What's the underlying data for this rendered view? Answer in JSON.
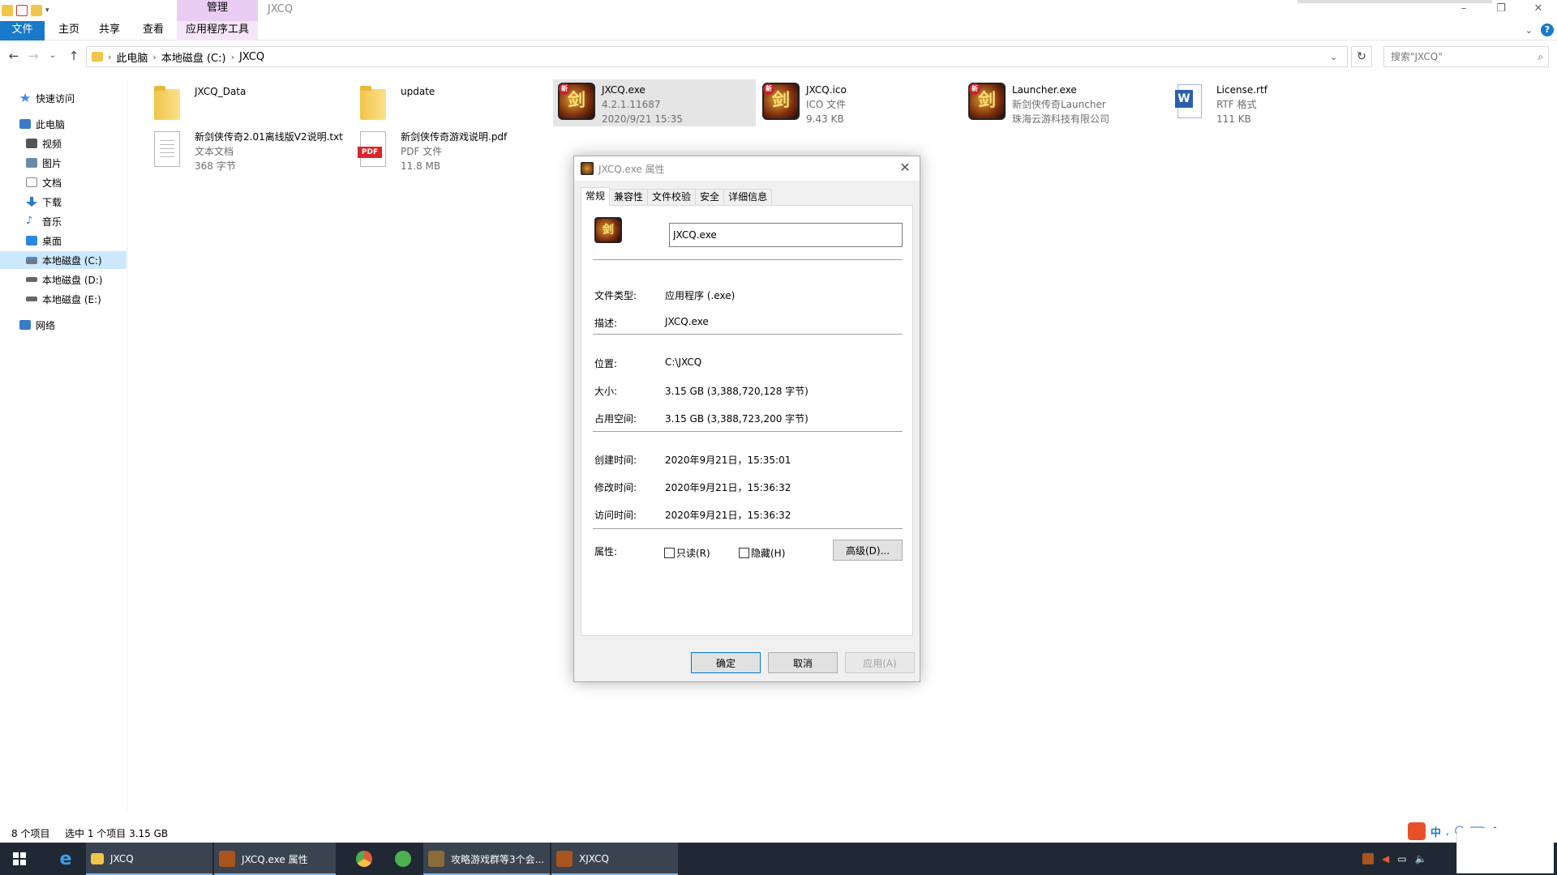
{
  "window": {
    "title": "JXCQ",
    "context_tab_header": "管理",
    "controls": [
      "–",
      "❐",
      "✕"
    ]
  },
  "ribbon": {
    "tabs": [
      "文件",
      "主页",
      "共享",
      "查看",
      "应用程序工具"
    ]
  },
  "address": {
    "breadcrumbs": [
      "此电脑",
      "本地磁盘 (C:)",
      "JXCQ"
    ],
    "search_placeholder": "搜索\"JXCQ\""
  },
  "nav": {
    "items": [
      {
        "label": "快速访问",
        "icon": "star-icon",
        "color": "#3d8ee0"
      },
      {
        "label": "此电脑",
        "icon": "computer-icon",
        "color": "#3a7bc8"
      },
      {
        "label": "视频",
        "icon": "video-icon",
        "color": "#555"
      },
      {
        "label": "图片",
        "icon": "picture-icon",
        "color": "#555"
      },
      {
        "label": "文档",
        "icon": "document-icon",
        "color": "#777"
      },
      {
        "label": "下载",
        "icon": "download-icon",
        "color": "#2a78d4"
      },
      {
        "label": "音乐",
        "icon": "music-icon",
        "color": "#2a78d4"
      },
      {
        "label": "桌面",
        "icon": "desktop-icon",
        "color": "#2a88e0"
      },
      {
        "label": "本地磁盘 (C:)",
        "icon": "drive-icon",
        "color": "#4a8ad4"
      },
      {
        "label": "本地磁盘 (D:)",
        "icon": "drive-icon",
        "color": "#666"
      },
      {
        "label": "本地磁盘 (E:)",
        "icon": "drive-icon",
        "color": "#666"
      },
      {
        "label": "网络",
        "icon": "network-icon",
        "color": "#3a7bc8"
      }
    ]
  },
  "files": [
    {
      "name": "JXCQ_Data",
      "lines": [],
      "icon": "folder-icon"
    },
    {
      "name": "update",
      "lines": [],
      "icon": "folder-icon"
    },
    {
      "name": "JXCQ.exe",
      "lines": [
        "4.2.1.11687",
        "2020/9/21 15:35"
      ],
      "icon": "game-icon"
    },
    {
      "name": "JXCQ.ico",
      "lines": [
        "ICO 文件",
        "9.43 KB"
      ],
      "icon": "game-icon"
    },
    {
      "name": "Launcher.exe",
      "lines": [
        "新剑侠传奇Launcher",
        "珠海云游科技有限公司"
      ],
      "icon": "game-icon"
    },
    {
      "name": "License.rtf",
      "lines": [
        "RTF 格式",
        "111 KB"
      ],
      "icon": "word-icon"
    },
    {
      "name": "新剑侠传奇2.01离线版V2说明.txt",
      "lines": [
        "文本文档",
        "368 字节"
      ],
      "icon": "text-file-icon"
    },
    {
      "name": "新剑侠传奇游戏说明.pdf",
      "lines": [
        "PDF 文件",
        "11.8 MB"
      ],
      "icon": "pdf-icon"
    }
  ],
  "game_icon_badge": "新",
  "game_icon_glyph": "剑",
  "pdf_label": "PDF",
  "word_label": "W",
  "dialog": {
    "title": "JXCQ.exe 属性",
    "tabs": [
      "常规",
      "兼容性",
      "文件校验",
      "安全",
      "详细信息"
    ],
    "file_name": "JXCQ.exe",
    "props": {
      "type_label": "文件类型:",
      "type_value": "应用程序 (.exe)",
      "desc_label": "描述:",
      "desc_value": "JXCQ.exe",
      "loc_label": "位置:",
      "loc_value": "C:\\JXCQ",
      "size_label": "大小:",
      "size_value": "3.15 GB (3,388,720,128 字节)",
      "disk_label": "占用空间:",
      "disk_value": "3.15 GB (3,388,723,200 字节)",
      "created_label": "创建时间:",
      "created_value": "2020年9月21日，15:35:01",
      "modified_label": "修改时间:",
      "modified_value": "2020年9月21日，15:36:32",
      "accessed_label": "访问时间:",
      "accessed_value": "2020年9月21日，15:36:32",
      "attr_label": "属性:"
    },
    "readonly_label": "只读(R)",
    "hidden_label": "隐藏(H)",
    "advanced_label": "高级(D)...",
    "ok_label": "确定",
    "cancel_label": "取消",
    "apply_label": "应用(A)"
  },
  "status": {
    "count": "8 个项目",
    "selection": "选中 1 个项目  3.15 GB"
  },
  "taskbar": {
    "items": [
      {
        "label": "JXCQ",
        "color": "#f0c64a"
      },
      {
        "label": "JXCQ.exe 属性",
        "color": "#a8541e"
      },
      {
        "label": "",
        "color": "#e05a3a"
      },
      {
        "label": "",
        "color": "#4caf50"
      },
      {
        "label": "攻略游戏群等3个会...",
        "color": "#8b6a3a"
      },
      {
        "label": "XJXCQ",
        "color": "#a8541e"
      }
    ],
    "ime_label": "中"
  }
}
